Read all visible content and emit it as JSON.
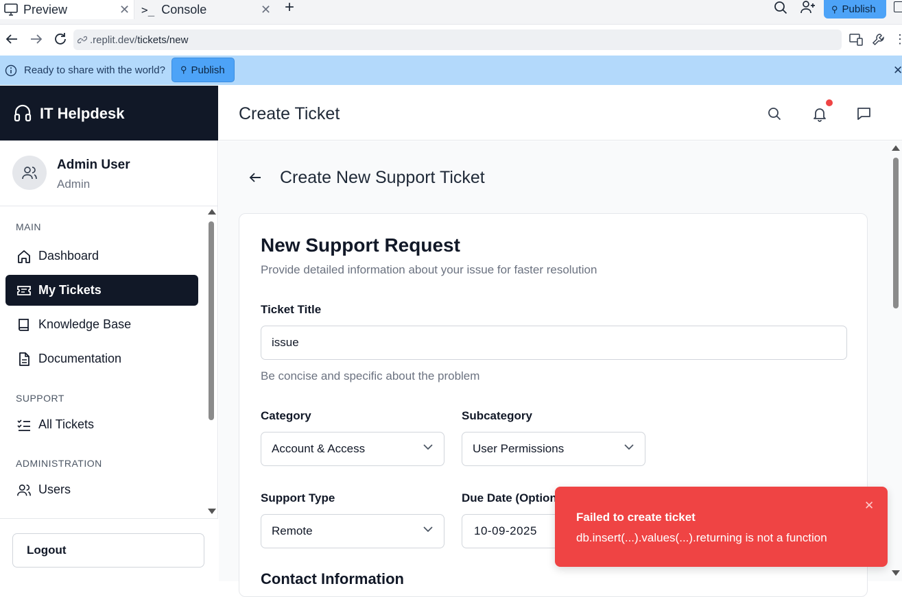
{
  "browser": {
    "tabs": [
      {
        "label": "Preview",
        "icon": "monitor-icon"
      },
      {
        "label": "Console",
        "icon": "terminal-icon"
      }
    ],
    "publish_label": "Publish",
    "url_prefix": ".replit.dev/",
    "url_path": "tickets/new"
  },
  "banner": {
    "message": "Ready to share with the world?",
    "publish_label": "Publish"
  },
  "sidebar": {
    "brand": "IT Helpdesk",
    "user_name": "Admin User",
    "user_role": "Admin",
    "sections": {
      "main": "MAIN",
      "support": "SUPPORT",
      "administration": "ADMINISTRATION"
    },
    "items": {
      "dashboard": "Dashboard",
      "my_tickets": "My Tickets",
      "knowledge_base": "Knowledge Base",
      "documentation": "Documentation",
      "all_tickets": "All Tickets",
      "users": "Users"
    },
    "logout": "Logout"
  },
  "header": {
    "title": "Create Ticket"
  },
  "page": {
    "heading": "Create New Support Ticket",
    "card_title": "New Support Request",
    "card_subtitle": "Provide detailed information about your issue for faster resolution",
    "ticket_title_label": "Ticket Title",
    "ticket_title_value": "issue",
    "ticket_title_help": "Be concise and specific about the problem",
    "category_label": "Category",
    "category_value": "Account & Access",
    "subcategory_label": "Subcategory",
    "subcategory_value": "User Permissions",
    "support_type_label": "Support Type",
    "support_type_value": "Remote",
    "due_date_label": "Due Date (Optional)",
    "due_date_value": "10-09-2025",
    "contact_heading": "Contact Information"
  },
  "toast": {
    "title": "Failed to create ticket",
    "message": "db.insert(...).values(...).returning is not a function"
  },
  "colors": {
    "sidebar_dark": "#111827",
    "banner": "#b3d9fb",
    "publish_button": "#4da3f7",
    "toast": "#ef4444",
    "notification_dot": "#ef4444"
  }
}
